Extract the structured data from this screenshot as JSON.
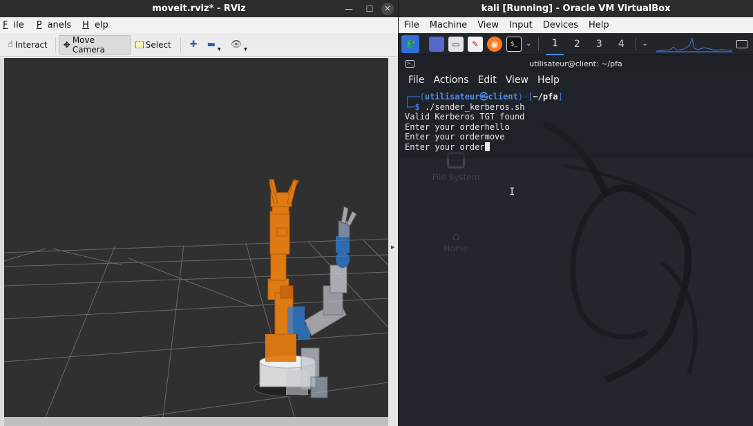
{
  "rviz": {
    "title": "moveit.rviz* - RViz",
    "window_controls": {
      "minimize": "—",
      "maximize": "☐",
      "close": "✕"
    },
    "menu": [
      {
        "prefix": "",
        "accel": "F",
        "rest": "ile"
      },
      {
        "prefix": "",
        "accel": "P",
        "rest": "anels"
      },
      {
        "prefix": "",
        "accel": "H",
        "rest": "elp"
      }
    ],
    "toolbar": {
      "interact": "Interact",
      "move_camera": "Move Camera",
      "select": "Select"
    }
  },
  "vbox": {
    "title": "kali [Running] - Oracle VM VirtualBox",
    "window_controls": {
      "minimize": "—",
      "maximize": "☐",
      "close": "✕"
    },
    "menu": [
      "File",
      "Machine",
      "View",
      "Input",
      "Devices",
      "Help"
    ],
    "workspaces": [
      "1",
      "2",
      "3",
      "4"
    ],
    "active_workspace": "1",
    "terminal": {
      "title": "utilisateur@client: ~/pfa",
      "menu": [
        "File",
        "Actions",
        "Edit",
        "View",
        "Help"
      ],
      "prompt_user": "utilisateur",
      "prompt_sep": "㉿",
      "prompt_host": "client",
      "prompt_path": "~/pfa",
      "command": "./sender_kerberos.sh",
      "lines": [
        "Valid Kerberos TGT found",
        "Enter your orderhello",
        "Enter your ordermove",
        "Enter your order"
      ]
    },
    "desktop_icons": [
      "File System",
      "Home"
    ]
  },
  "colors": {
    "robot_orange": "#e07a12",
    "robot_blue": "#2d7fd8",
    "grid": "#6b6b6b",
    "viewport_bg": "#303030",
    "kali_accent": "#3f7be0"
  }
}
